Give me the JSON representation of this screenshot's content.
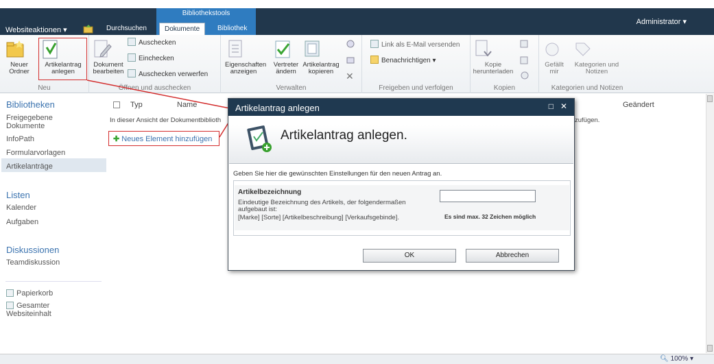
{
  "topbar": {
    "site_actions": "Websiteaktionen ▾",
    "context_group": "Bibliothekstools",
    "tabs": [
      {
        "label": "Durchsuchen"
      },
      {
        "label": "Dokumente"
      },
      {
        "label": "Bibliothek"
      }
    ],
    "user": "Administrator ▾"
  },
  "ribbon": {
    "groups": [
      {
        "title": "Neu"
      },
      {
        "title": "Öffnen und auschecken"
      },
      {
        "title": "Verwalten"
      },
      {
        "title": "Freigeben und verfolgen"
      },
      {
        "title": "Kopien"
      },
      {
        "title": "Kategorien und Notizen"
      }
    ],
    "neuer_ordner": [
      "Neuer",
      "Ordner"
    ],
    "artikelantrag": [
      "Artikelantrag",
      "anlegen"
    ],
    "dokument_bearbeiten": [
      "Dokument",
      "bearbeiten"
    ],
    "auschecken": "Auschecken",
    "einchecken": "Einchecken",
    "auschecken_verwerfen": "Auschecken verwerfen",
    "eigenschaften": [
      "Eigenschaften",
      "anzeigen"
    ],
    "vertreter": [
      "Vertreter",
      "ändern"
    ],
    "artikelantrag_kopieren": [
      "Artikelantrag",
      "kopieren"
    ],
    "link_email": "Link als E-Mail versenden",
    "benachrichtigen": "Benachrichtigen ▾",
    "kopie_herunterladen": [
      "Kopie",
      "herunterladen"
    ],
    "gefaellt_mir": [
      "Gefällt",
      "mir"
    ],
    "kategorien_notizen": [
      "Kategorien und",
      "Notizen"
    ]
  },
  "leftnav": {
    "bibliotheken": "Bibliotheken",
    "lib_items": [
      "Freigegebene",
      "Dokumente",
      "InfoPath",
      "Formularvorlagen",
      "Artikelanträge"
    ],
    "listen": "Listen",
    "list_items": [
      "Kalender",
      "Aufgaben"
    ],
    "diskussionen": "Diskussionen",
    "disc_items": [
      "Teamdiskussion"
    ],
    "papierkorb": "Papierkorb",
    "gesamter": [
      "Gesamter",
      "Websiteinhalt"
    ]
  },
  "main": {
    "col_typ": "Typ",
    "col_name": "Name",
    "col_geaendert": "Geändert",
    "empty_text": "In dieser Ansicht der Dokumentbiblioth",
    "empty_tail": "zufügen.",
    "add_item": "Neues Element hinzufügen"
  },
  "dialog": {
    "title": "Artikelantrag anlegen",
    "heading": "Artikelantrag anlegen.",
    "instruction": "Geben Sie hier die gewünschten Einstellungen für den neuen Antrag an.",
    "field_label": "Artikelbezeichnung",
    "field_desc": [
      "Eindeutige Bezeichnung des Artikels, der folgendermaßen",
      "aufgebaut ist:",
      "[Marke] [Sorte] [Artikelbeschreibung] [Verkaufsgebinde]."
    ],
    "field_value": "",
    "hint": "Es sind max. 32 Zeichen möglich",
    "ok": "OK",
    "cancel": "Abbrechen"
  },
  "status": {
    "zoom": "100%"
  }
}
